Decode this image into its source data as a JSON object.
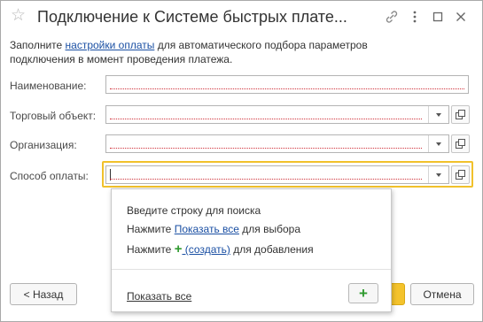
{
  "window": {
    "title": "Подключение к Системе быстрых плате..."
  },
  "intro": {
    "before_link": "Заполните ",
    "link": "настройки оплаты",
    "after_link": " для автоматического подбора параметров подключения в момент проведения платежа."
  },
  "fields": {
    "name": {
      "label": "Наименование:",
      "value": ""
    },
    "trade_object": {
      "label": "Торговый объект:",
      "value": ""
    },
    "organization": {
      "label": "Организация:",
      "value": ""
    },
    "payment_method": {
      "label": "Способ оплаты:",
      "value": ""
    }
  },
  "dropdown": {
    "hint_line1": "Введите строку для поиска",
    "line2_prefix": "Нажмите ",
    "line2_link": "Показать все",
    "line2_suffix": " для выбора",
    "line3_prefix": "Нажмите ",
    "line3_link": " (создать)",
    "line3_suffix": " для добавления",
    "show_all_link": "Показать все"
  },
  "buttons": {
    "back": "< Назад",
    "cancel": "Отмена"
  },
  "colors": {
    "accent_yellow": "#f4c32c",
    "link_blue": "#1a4fa3",
    "required_red": "#d0313a",
    "add_green": "#2f9a2f"
  }
}
